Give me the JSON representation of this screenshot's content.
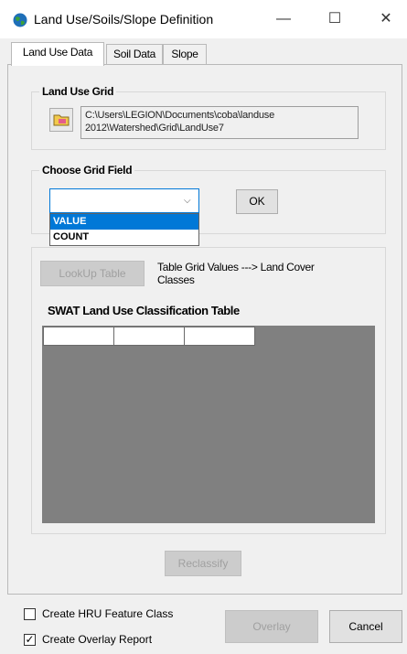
{
  "window": {
    "title": "Land Use/Soils/Slope Definition",
    "minimize_glyph": "—",
    "maximize_glyph": "☐",
    "close_glyph": "✕"
  },
  "tabs": [
    {
      "label": "Land Use Data",
      "active": true
    },
    {
      "label": "Soil Data",
      "active": false
    },
    {
      "label": "Slope",
      "active": false
    }
  ],
  "land_use_grid": {
    "title": "Land Use Grid",
    "path_line1": "C:\\Users\\LEGION\\Documents\\coba\\landuse",
    "path_line2": "2012\\Watershed\\Grid\\LandUse7"
  },
  "choose_grid_field": {
    "title": "Choose Grid Field",
    "selected_value": "",
    "ok_label": "OK",
    "options": [
      "VALUE",
      "COUNT"
    ],
    "highlighted_option": "VALUE"
  },
  "lookup": {
    "button_label": "LookUp Table",
    "description_line1": "Table Grid Values ---> Land Cover",
    "description_line2": "Classes"
  },
  "classification_table": {
    "title": "SWAT Land Use Classification Table"
  },
  "reclassify_label": "Reclassify",
  "footer": {
    "create_hru_label": "Create HRU Feature Class",
    "create_hru_checked": false,
    "create_overlay_label": "Create Overlay Report",
    "create_overlay_checked": true,
    "overlay_label": "Overlay",
    "cancel_label": "Cancel"
  },
  "colors": {
    "accent": "#0078d7",
    "grid_background": "#808080",
    "dialog_background": "#f0f0f0"
  }
}
